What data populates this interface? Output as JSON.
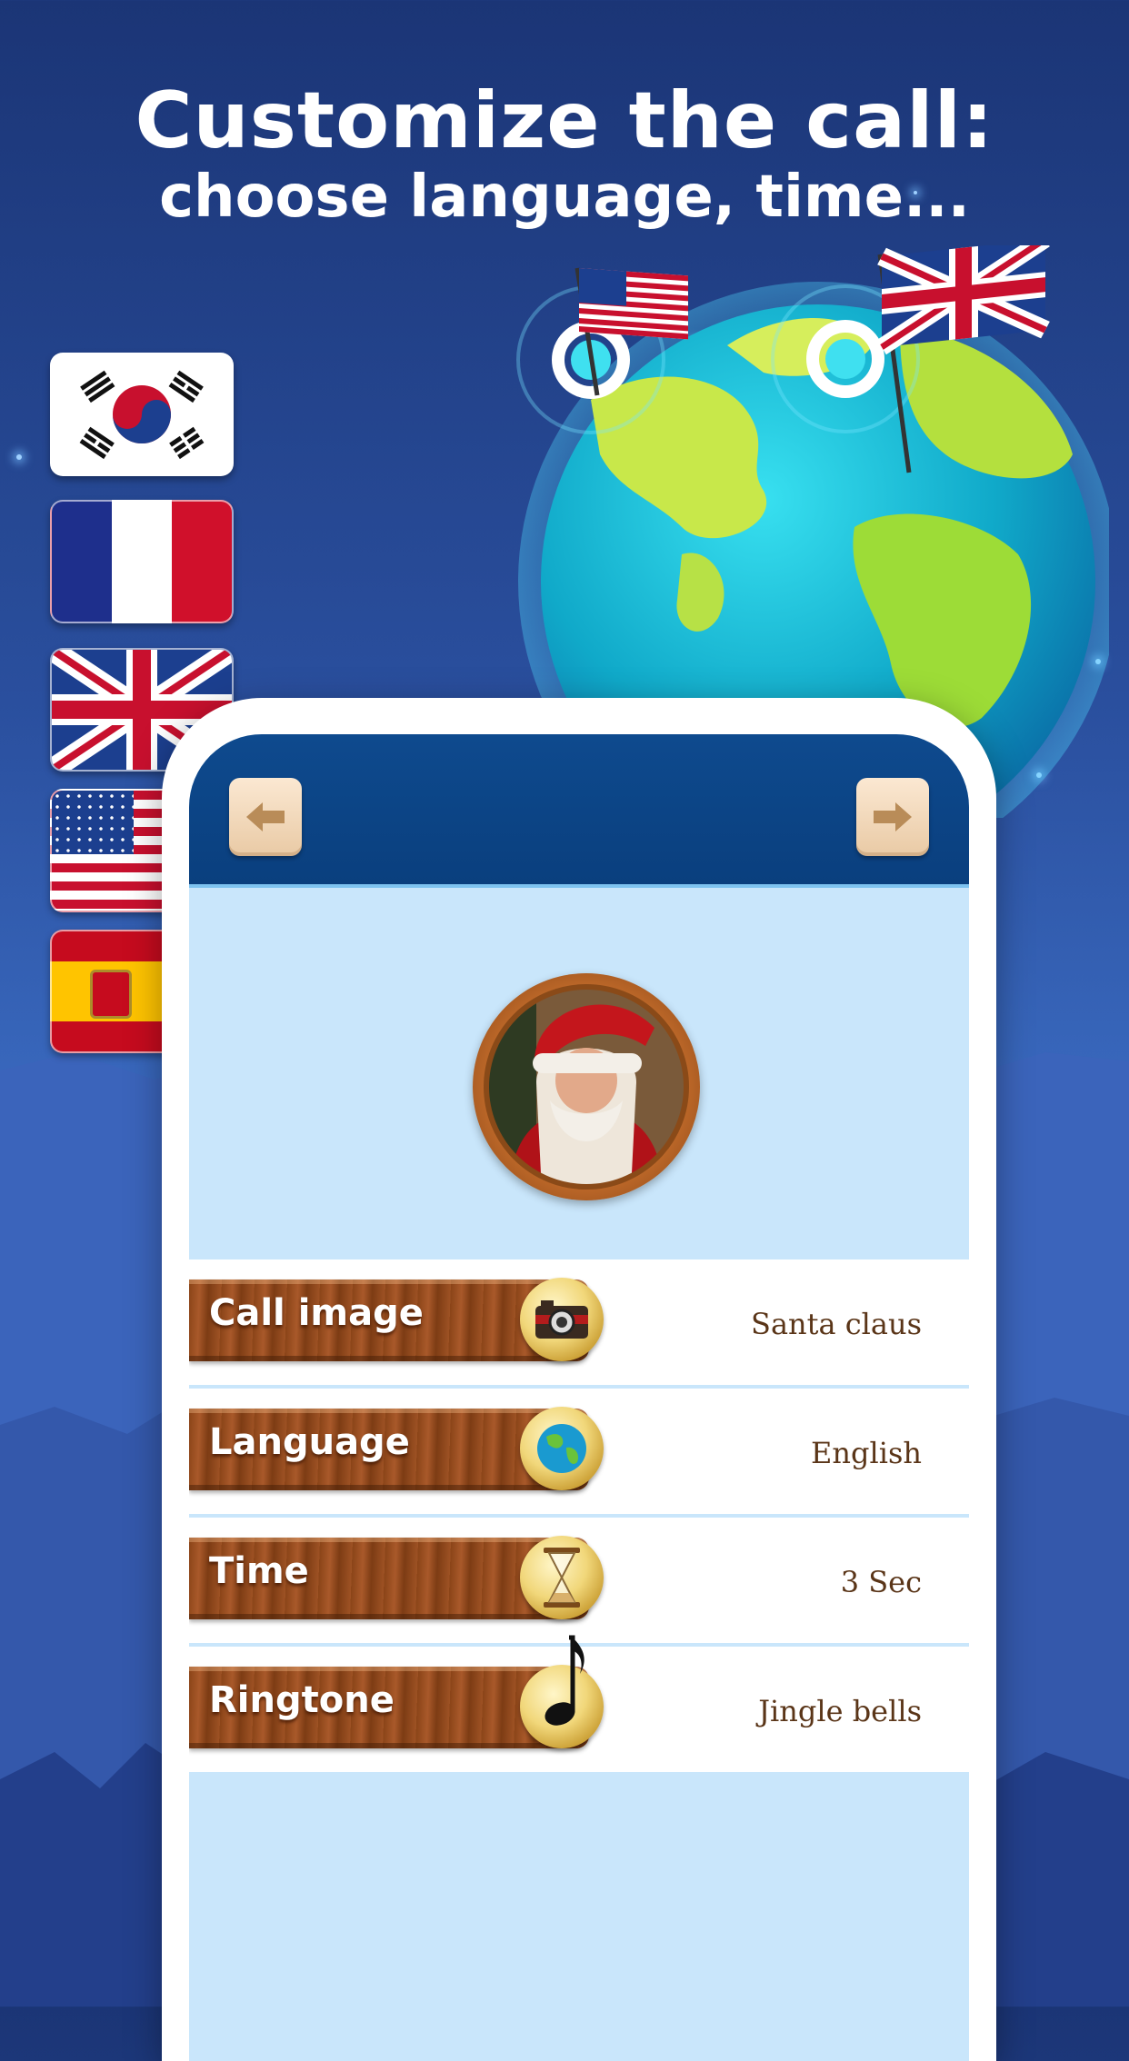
{
  "headline": {
    "line1": "Customize the call:",
    "line2": "choose language, time..."
  },
  "flags": [
    "south-korea-flag",
    "france-flag",
    "uk-flag",
    "usa-flag",
    "spain-flag"
  ],
  "app": {
    "back_icon": "arrow-left-icon",
    "forward_icon": "arrow-right-icon",
    "avatar": "santa-claus-portrait",
    "settings": [
      {
        "label": "Call image",
        "icon": "camera-icon",
        "value": "Santa claus"
      },
      {
        "label": "Language",
        "icon": "globe-icon",
        "value": "English"
      },
      {
        "label": "Time",
        "icon": "hourglass-icon",
        "value": "3 Sec"
      },
      {
        "label": "Ringtone",
        "icon": "music-note-icon",
        "value": "Jingle bells"
      }
    ]
  },
  "colors": {
    "background": "#2a4f9e",
    "topbar": "#0e4a8e",
    "screen": "#c9e6fb",
    "plank": "#9e5224",
    "value_text": "#5a3518"
  }
}
